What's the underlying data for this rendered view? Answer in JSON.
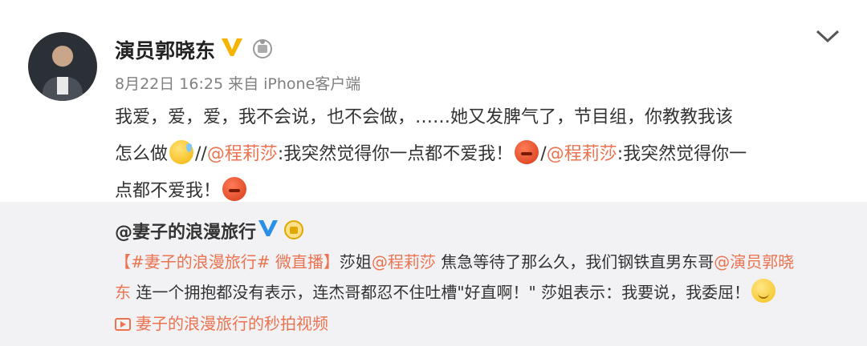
{
  "post": {
    "username": "演员郭晓东",
    "meta": "8月22日 16:25 来自 iPhone客户端",
    "line1": "我爱，爱，爱，我不会说，也不会做，……她又发脾气了，节目组，你教教我该",
    "line2_a": "怎么做",
    "line2_b": "//",
    "mention1": "@程莉莎",
    "line2_c": ":我突然觉得你一点都不爱我！",
    "line2_d": "/",
    "mention2": "@程莉莎",
    "line2_e": ":我突然觉得你一",
    "line3": "点都不爱我！",
    "icons": [
      "verified-v-icon",
      "medal-icon",
      "chevron-down-icon"
    ]
  },
  "repost": {
    "username": "@妻子的浪漫旅行",
    "tag": "【#妻子的浪漫旅行# 微直播】",
    "text1": "莎姐",
    "mention1": "@程莉莎",
    "text2": " 焦急等待了那么久，我们钢铁直男东哥",
    "mention2a": "@演员郭晓",
    "mention2b": "东",
    "line2": " 连一个拥抱都没有表示，连杰哥都忍不住吐槽\"好直啊！\" 莎姐表示：我要说，我委屈！",
    "video_link": "妻子的浪漫旅行的秒拍视频"
  },
  "colors": {
    "link": "#eb7350",
    "repost_bg": "#f2f2f5",
    "meta": "#808080"
  }
}
